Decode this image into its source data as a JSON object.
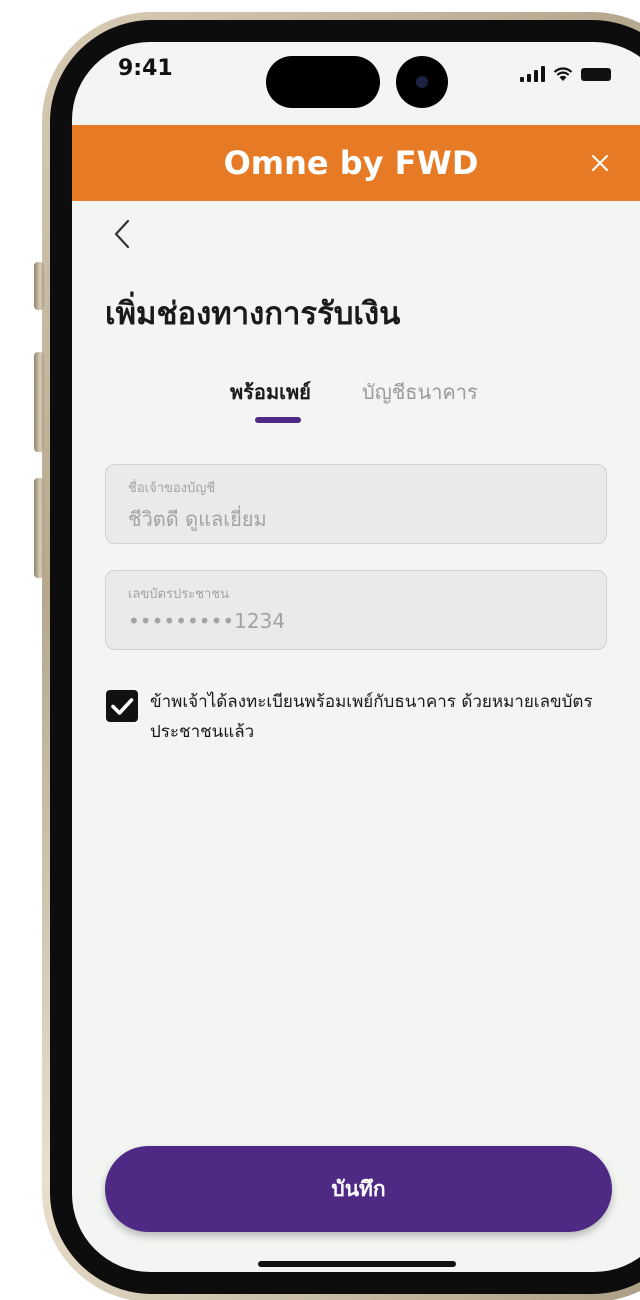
{
  "status_bar": {
    "time": "9:41"
  },
  "header": {
    "title": "Omne by FWD",
    "background_color": "#e77a24"
  },
  "page": {
    "title": "เพิ่มช่องทางการรับเงิน"
  },
  "tabs": [
    {
      "label": "พร้อมเพย์",
      "active": true
    },
    {
      "label": "บัญชีธนาคาร",
      "active": false
    }
  ],
  "fields": [
    {
      "label": "ชื่อเจ้าของบัญชี",
      "value": "ชีวิตดี ดูแลเยี่ยม"
    },
    {
      "label": "เลขบัตรประชาชน",
      "value": "•••••••••1234"
    }
  ],
  "consent": {
    "checked": true,
    "text": "ข้าพเจ้าได้ลงทะเบียนพร้อมเพย์กับธนาคาร ด้วยหมายเลขบัตรประชาชนแล้ว"
  },
  "actions": {
    "save_label": "บันทึก"
  },
  "colors": {
    "brand_orange": "#e77a24",
    "primary_purple": "#4e2a84",
    "screen_background": "#f2f5f1"
  },
  "icons": {
    "back": "chevron-left-icon",
    "close": "close-icon",
    "check": "check-icon"
  }
}
